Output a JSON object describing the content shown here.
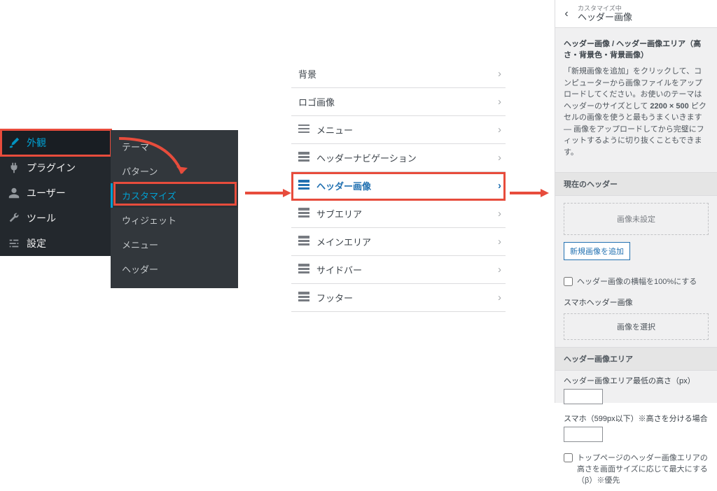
{
  "wp_sidebar": {
    "items": [
      {
        "icon": "brush",
        "label": "外観",
        "active": true
      },
      {
        "icon": "plug",
        "label": "プラグイン"
      },
      {
        "icon": "user",
        "label": "ユーザー"
      },
      {
        "icon": "wrench",
        "label": "ツール"
      },
      {
        "icon": "sliders",
        "label": "設定"
      }
    ]
  },
  "submenu": {
    "items": [
      {
        "label": "テーマ"
      },
      {
        "label": "パターン"
      },
      {
        "label": "カスタマイズ",
        "active": true
      },
      {
        "label": "ウィジェット"
      },
      {
        "label": "メニュー"
      },
      {
        "label": "ヘッダー"
      }
    ]
  },
  "mid": {
    "rows": [
      {
        "label": "背景",
        "icon": null
      },
      {
        "label": "ロゴ画像",
        "icon": null
      },
      {
        "label": "メニュー",
        "icon": "hamburger"
      },
      {
        "label": "ヘッダーナビゲーション",
        "icon": "bars"
      },
      {
        "label": "ヘッダー画像",
        "icon": "bars",
        "active": true
      },
      {
        "label": "サブエリア",
        "icon": "bars"
      },
      {
        "label": "メインエリア",
        "icon": "bars"
      },
      {
        "label": "サイドバー",
        "icon": "bars"
      },
      {
        "label": "フッター",
        "icon": "bars"
      }
    ]
  },
  "panel": {
    "sup": "カスタマイズ中",
    "title": "ヘッダー画像",
    "section_title": "ヘッダー画像 / ヘッダー画像エリア（高さ・背景色・背景画像）",
    "desc_pre": "「新規画像を追加」をクリックして、コンピューターから画像ファイルをアップロードしてください。お使いのテーマはヘッダーのサイズとして ",
    "desc_size": "2200 × 500",
    "desc_post": " ピクセルの画像を使うと最もうまくいきます — 画像をアップロードしてから完璧にフィットするように切り抜くこともできます。",
    "current_header": "現在のヘッダー",
    "noimg": "画像未設定",
    "addnew": "新規画像を追加",
    "chk100": "ヘッダー画像の横幅を100%にする",
    "sp_label": "スマホヘッダー画像",
    "selimg": "画像を選択",
    "area_title": "ヘッダー画像エリア",
    "min_h": "ヘッダー画像エリア最低の高さ（px）",
    "sp_h": "スマホ（599px以下）※高さを分ける場合",
    "chk_top": "トップページのヘッダー画像エリアの高さを画面サイズに応じて最大にする（β）※優先"
  }
}
